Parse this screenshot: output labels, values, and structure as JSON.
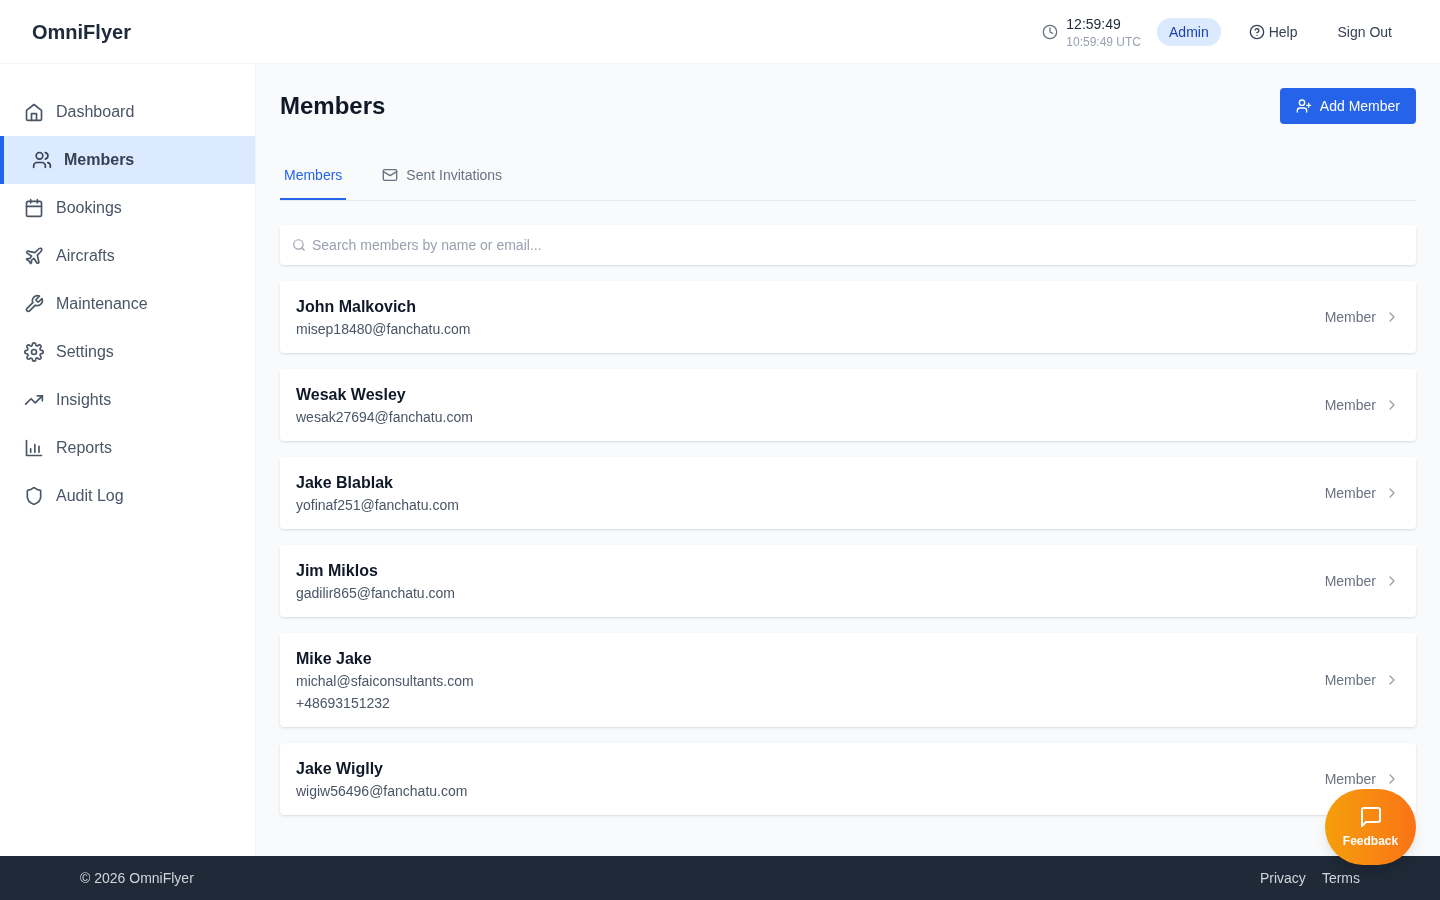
{
  "app": {
    "name": "OmniFlyer"
  },
  "header": {
    "time": "12:59:49",
    "utc_time": "10:59:49 UTC",
    "role_badge": "Admin",
    "help": "Help",
    "sign_out": "Sign Out"
  },
  "sidebar": {
    "items": [
      {
        "label": "Dashboard",
        "selected": false
      },
      {
        "label": "Members",
        "selected": true
      },
      {
        "label": "Bookings",
        "selected": false
      },
      {
        "label": "Aircrafts",
        "selected": false
      },
      {
        "label": "Maintenance",
        "selected": false
      },
      {
        "label": "Settings",
        "selected": false
      },
      {
        "label": "Insights",
        "selected": false
      },
      {
        "label": "Reports",
        "selected": false
      },
      {
        "label": "Audit Log",
        "selected": false
      }
    ]
  },
  "page": {
    "title": "Members",
    "add_button": "Add Member"
  },
  "tabs": [
    {
      "label": "Members",
      "selected": true
    },
    {
      "label": "Sent Invitations",
      "selected": false
    }
  ],
  "search": {
    "placeholder": "Search members by name or email..."
  },
  "members": [
    {
      "name": "John Malkovich",
      "email": "misep18480@fanchatu.com",
      "role": "Member"
    },
    {
      "name": "Wesak Wesley",
      "email": "wesak27694@fanchatu.com",
      "role": "Member"
    },
    {
      "name": "Jake Blablak",
      "email": "yofinaf251@fanchatu.com",
      "role": "Member"
    },
    {
      "name": "Jim Miklos",
      "email": "gadilir865@fanchatu.com",
      "role": "Member"
    },
    {
      "name": "Mike Jake",
      "email": "michal@sfaiconsultants.com",
      "phone": "+48693151232",
      "role": "Member"
    },
    {
      "name": "Jake Wiglly",
      "email": "wigiw56496@fanchatu.com",
      "role": "Member"
    }
  ],
  "footer": {
    "copyright": "© 2026 OmniFlyer",
    "links": [
      "Privacy",
      "Terms"
    ]
  },
  "feedback_button": "Feedback"
}
